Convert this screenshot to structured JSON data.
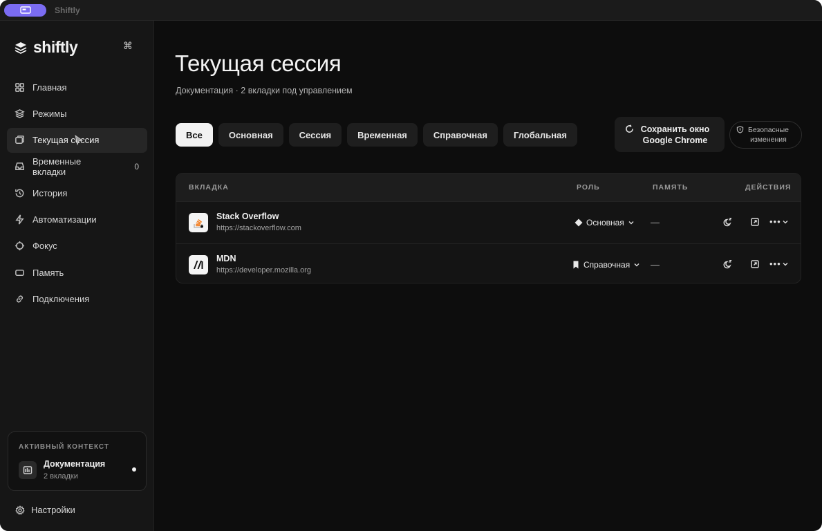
{
  "window": {
    "title": "Shiftly"
  },
  "sidebar": {
    "logo_text": "shiftly",
    "cmd_glyph": "⌘",
    "items": [
      {
        "label": "Главная",
        "icon": "grid-icon"
      },
      {
        "label": "Режимы",
        "icon": "layers-icon"
      },
      {
        "label": "Текущая сессия",
        "icon": "windows-icon",
        "active": true
      },
      {
        "label": "Временные вкладки",
        "icon": "inbox-icon",
        "count": "0"
      },
      {
        "label": "История",
        "icon": "history-icon"
      },
      {
        "label": "Автоматизации",
        "icon": "bolt-icon"
      },
      {
        "label": "Фокус",
        "icon": "crosshair-icon"
      },
      {
        "label": "Память",
        "icon": "memory-icon"
      },
      {
        "label": "Подключения",
        "icon": "link-icon"
      }
    ],
    "context": {
      "label": "АКТИВНЫЙ КОНТЕКСТ",
      "name": "Документация",
      "sub": "2 вкладки"
    },
    "settings_label": "Настройки"
  },
  "main": {
    "title": "Текущая сессия",
    "subtitle": "Документация · 2 вкладки под управлением",
    "filters": [
      "Все",
      "Основная",
      "Сессия",
      "Временная",
      "Справочная",
      "Глобальная"
    ],
    "active_filter": 0,
    "save_button": "Сохранить окно Google Chrome",
    "safe_button": "Безопасные изменения",
    "table": {
      "headers": {
        "tab": "ВКЛАДКА",
        "role": "РОЛЬ",
        "memory": "ПАМЯТЬ",
        "actions": "ДЕЙСТВИЯ"
      },
      "rows": [
        {
          "title": "Stack Overflow",
          "url": "https://stackoverflow.com",
          "role": "Основная",
          "role_icon": "diamond-icon",
          "memory": "—",
          "favicon": "stackoverflow-icon"
        },
        {
          "title": "MDN",
          "url": "https://developer.mozilla.org",
          "role": "Справочная",
          "role_icon": "bookmark-icon",
          "memory": "—",
          "favicon": "mdn-icon"
        }
      ]
    }
  },
  "colors": {
    "accent": "#7b6cf2",
    "background": "#0d0d0d",
    "sidebar": "#161616"
  }
}
